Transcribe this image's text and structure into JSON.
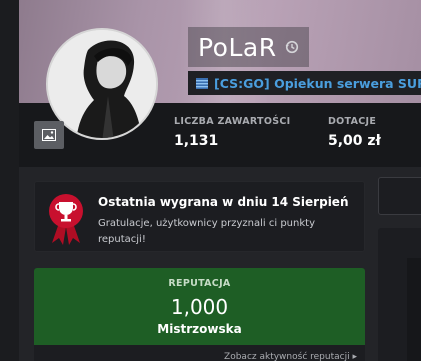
{
  "profile": {
    "name": "PoLaR",
    "rank": "[CS:GO] Opiekun serwera SURF"
  },
  "stats": [
    {
      "label": "LICZBA ZAWARTOŚCI",
      "value": "1,131"
    },
    {
      "label": "DOTACJE",
      "value": "5,00 zł"
    }
  ],
  "award": {
    "title": "Ostatnia wygrana w dniu 14 Sierpień",
    "description": "Gratulacje, użytkownicy przyznali ci punkty reputacji!"
  },
  "reputation": {
    "label": "REPUTACJA",
    "value": "1,000",
    "title": "Mistrzowska",
    "link": "Zobacz aktywność reputacji"
  },
  "colors": {
    "rank_blue": "#4a9ede",
    "reputation_green": "#1e5e25",
    "award_red": "#c8102e"
  },
  "icons": {
    "name_history": "history-icon",
    "rank_flag": "flag-icon",
    "cover_photo": "image-icon",
    "award": "trophy-ribbon-icon"
  }
}
